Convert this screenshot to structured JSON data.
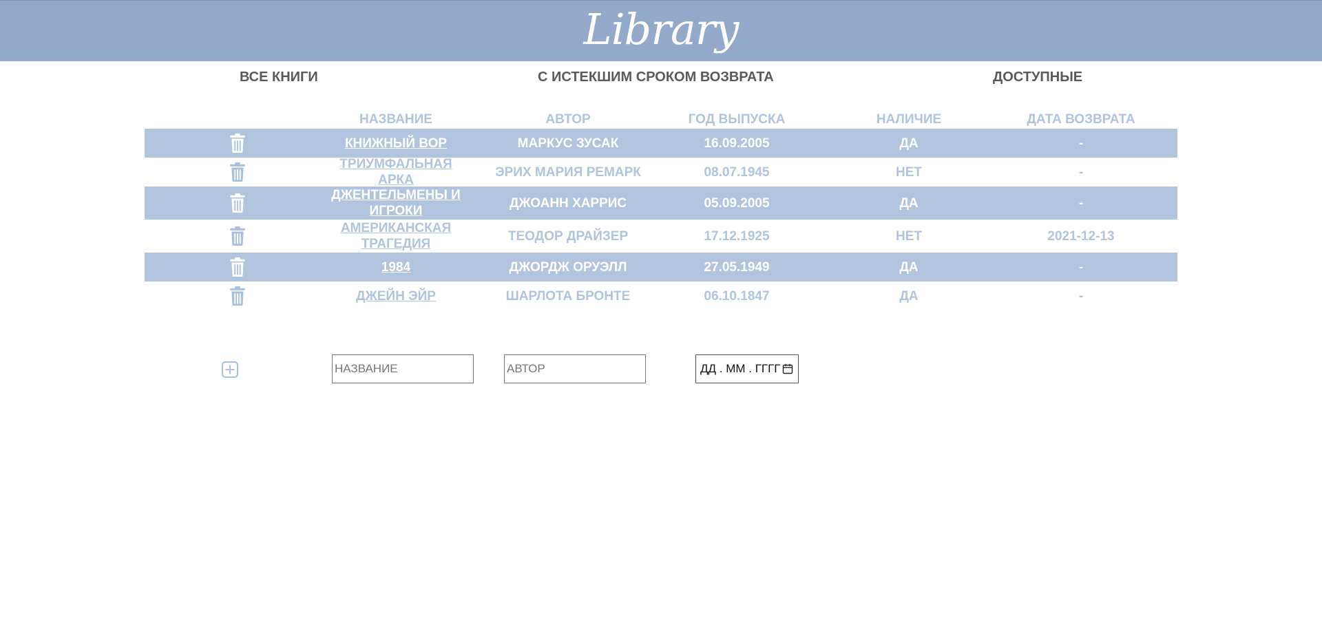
{
  "header": {
    "logo": "Library"
  },
  "nav": {
    "all_books": "ВСЕ КНИГИ",
    "overdue": "С ИСТЕКШИМ СРОКОМ ВОЗВРАТА",
    "available": "ДОСТУПНЫЕ"
  },
  "table": {
    "columns": [
      "НАЗВАНИЕ",
      "АВТОР",
      "ГОД ВЫПУСКА",
      "НАЛИЧИЕ",
      "ДАТА ВОЗВРАТА"
    ],
    "rows": [
      {
        "title": "КНИЖНЫЙ ВОР",
        "author": "МАРКУС ЗУСАК",
        "year": "16.09.2005",
        "available": "ДА",
        "return_date": "-"
      },
      {
        "title": "ТРИУМФАЛЬНАЯ АРКА",
        "author": "ЭРИХ МАРИЯ РЕМАРК",
        "year": "08.07.1945",
        "available": "НЕТ",
        "return_date": "-"
      },
      {
        "title": "ДЖЕНТЕЛЬМЕНЫ И ИГРОКИ",
        "author": "ДЖОАНН ХАРРИС",
        "year": "05.09.2005",
        "available": "ДА",
        "return_date": "-"
      },
      {
        "title": "АМЕРИКАНСКАЯ ТРАГЕДИЯ",
        "author": "ТЕОДОР ДРАЙЗЕР",
        "year": "17.12.1925",
        "available": "НЕТ",
        "return_date": "2021-12-13"
      },
      {
        "title": "1984",
        "author": "ДЖОРДЖ ОРУЭЛЛ",
        "year": "27.05.1949",
        "available": "ДА",
        "return_date": "-"
      },
      {
        "title": "ДЖЕЙН ЭЙР",
        "author": "ШАРЛОТА БРОНТЕ",
        "year": "06.10.1847",
        "available": "ДА",
        "return_date": "-"
      }
    ]
  },
  "add_form": {
    "title_placeholder": "НАЗВАНИЕ",
    "author_placeholder": "АВТОР",
    "date_placeholder": "ДД . ММ . ГГГГ"
  },
  "colors": {
    "header_bg": "#93a9c9",
    "row_accent": "#b0c4de",
    "nav_text": "#5a5a5a"
  }
}
